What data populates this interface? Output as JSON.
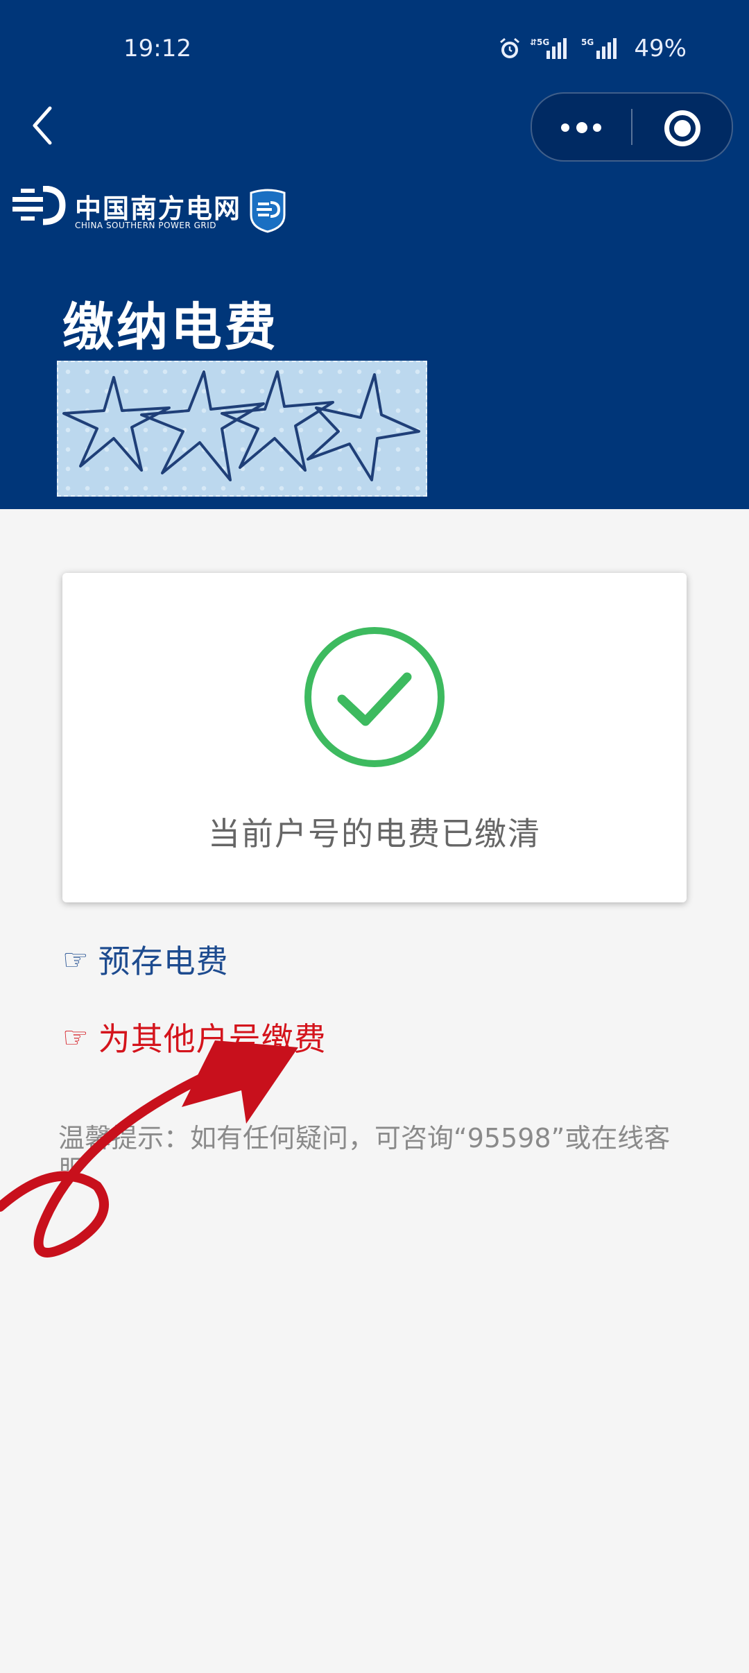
{
  "status_bar": {
    "time": "19:12",
    "battery": "49%",
    "signal_icons": [
      "alarm-icon",
      "5g-signal-icon",
      "5g-signal-icon"
    ]
  },
  "nav": {
    "back_icon": "chevron-left-icon",
    "more_icon": "more-dots-icon",
    "close_icon": "target-close-icon"
  },
  "brand": {
    "name_cn": "中国南方电网",
    "name_en": "CHINA SOUTHERN POWER GRID"
  },
  "page": {
    "title": "缴纳电费"
  },
  "card": {
    "message": "当前户号的电费已缴清",
    "icon": "check-circle-icon",
    "icon_color": "#3dba5f"
  },
  "links": {
    "hand_icon": "☞",
    "prestore": "预存电费",
    "prestore_color": "#1d4b8f",
    "other_account": "为其他户号缴费",
    "other_account_color": "#d4141c"
  },
  "tip": {
    "text": "温馨提示：如有任何疑问，可咨询“95598”或在线客服"
  },
  "colors": {
    "header_bg": "#003679",
    "page_bg": "#f5f5f5",
    "annotation": "#c8101c"
  }
}
